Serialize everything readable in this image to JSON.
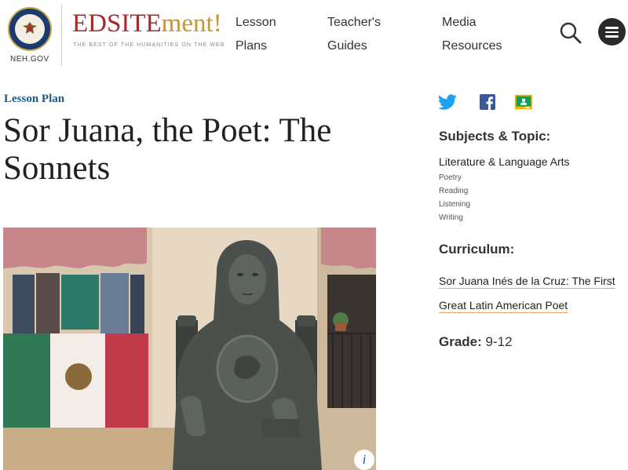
{
  "header": {
    "agency_label": "NEH.GOV",
    "brand_part1": "EDSITE",
    "brand_part2": "ment!",
    "tagline": "THE BEST OF THE HUMANITIES ON THE WEB",
    "nav": [
      {
        "line1": "Lesson",
        "line2": "Plans"
      },
      {
        "line1": "Teacher's",
        "line2": "Guides"
      },
      {
        "line1": "Media",
        "line2": "Resources"
      }
    ],
    "search_icon": "search-icon",
    "menu_icon": "hamburger-menu-icon"
  },
  "main": {
    "kicker": "Lesson Plan",
    "title": "Sor Juana, the Poet: The Sonnets",
    "info_label": "i"
  },
  "sidebar": {
    "share_icons": [
      "twitter-icon",
      "facebook-icon",
      "google-classroom-icon"
    ],
    "subjects_heading": "Subjects & Topic:",
    "subject_main": "Literature & Language Arts",
    "subject_items": [
      "Poetry",
      "Reading",
      "Listening",
      "Writing"
    ],
    "curriculum_heading": "Curriculum:",
    "curriculum_line1": "Sor Juana Inés de la Cruz: The First",
    "curriculum_line2": "Great Latin American Poet",
    "grade_label": "Grade:",
    "grade_value": "9-12"
  },
  "colors": {
    "brand_red": "#a52a2a",
    "brand_gold": "#c9952c",
    "kicker_blue": "#1b5a8c",
    "twitter": "#1da1f2",
    "facebook": "#3b5998",
    "link_underline": "#e8a86a"
  }
}
